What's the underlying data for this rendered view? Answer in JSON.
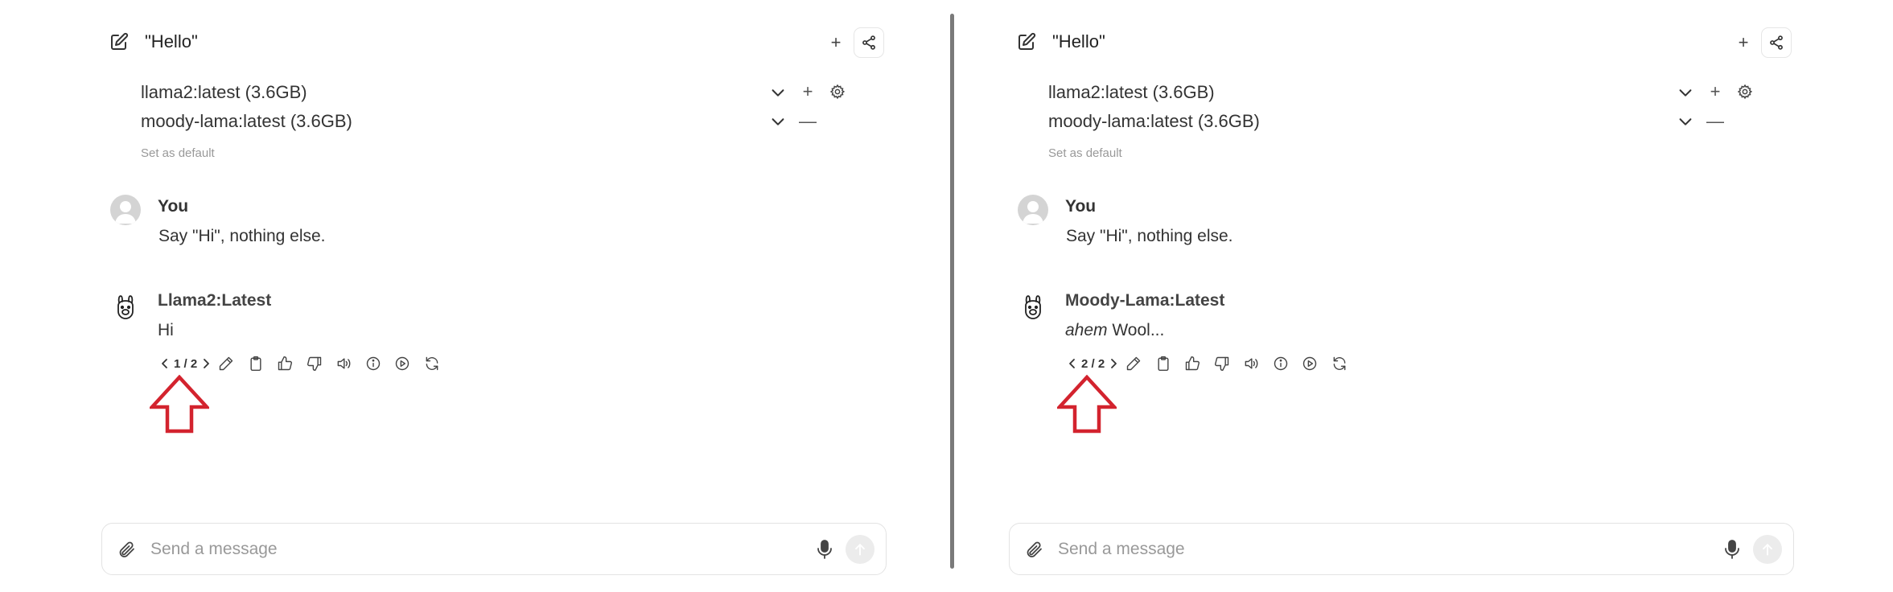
{
  "panels": [
    {
      "chat_title": "\"Hello\"",
      "new_button": "+",
      "models": [
        {
          "name": "llama2:latest (3.6GB)",
          "action": "+"
        },
        {
          "name": "moody-lama:latest (3.6GB)",
          "action": "—"
        }
      ],
      "set_default": "Set as default",
      "user": {
        "name": "You",
        "message": "Say \"Hi\", nothing else."
      },
      "bot": {
        "name": "Llama2:Latest",
        "message_emphasis": "",
        "message": "Hi",
        "pager": "1 / 2"
      },
      "input": {
        "placeholder": "Send a message"
      }
    },
    {
      "chat_title": "\"Hello\"",
      "new_button": "+",
      "models": [
        {
          "name": "llama2:latest (3.6GB)",
          "action": "+"
        },
        {
          "name": "moody-lama:latest (3.6GB)",
          "action": "—"
        }
      ],
      "set_default": "Set as default",
      "user": {
        "name": "You",
        "message": "Say \"Hi\", nothing else."
      },
      "bot": {
        "name": "Moody-Lama:Latest",
        "message_emphasis": "ahem",
        "message": " Wool...",
        "pager": "2 / 2"
      },
      "input": {
        "placeholder": "Send a message"
      }
    }
  ],
  "icons": {
    "new_chat": "edit-square-icon",
    "share": "share-icon",
    "chevron": "chevron-down-icon",
    "settings": "gear-icon",
    "user_avatar": "user-avatar-icon",
    "bot_avatar": "llama-icon",
    "actions": [
      "pencil-icon",
      "clipboard-icon",
      "thumbs-up-icon",
      "thumbs-down-icon",
      "speaker-icon",
      "info-icon",
      "play-icon",
      "regenerate-icon"
    ],
    "attach": "paperclip-icon",
    "mic": "microphone-icon",
    "send": "arrow-up-icon",
    "annotation": "red-up-arrow-icon"
  },
  "colors": {
    "annotation_arrow": "#d3232e",
    "divider": "#7a7a7a",
    "muted_text": "#999999"
  }
}
